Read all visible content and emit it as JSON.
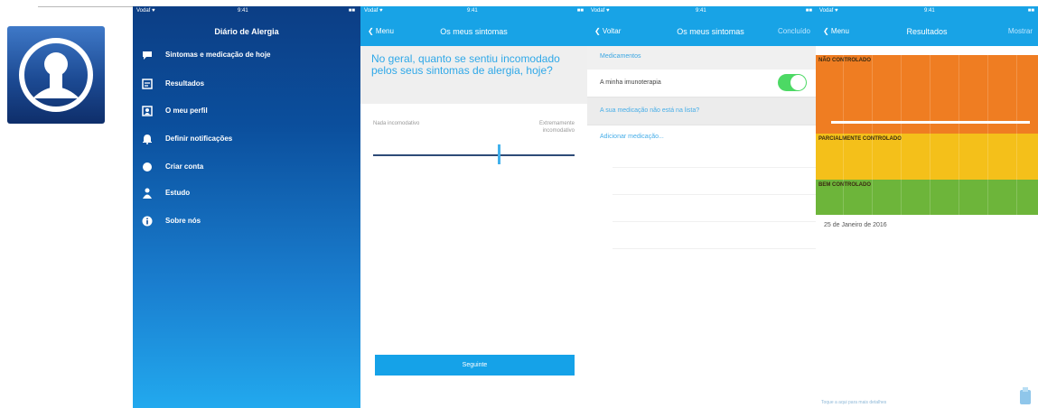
{
  "screens": {
    "menu": {
      "status": {
        "carrier": "Vodaf ♥",
        "time": "9:41",
        "battery": "■■"
      },
      "title": "Diário de Alergia",
      "items": [
        {
          "label": "Sintomas e medicação de hoje",
          "icon": "speech-bubble-icon"
        },
        {
          "label": "Resultados",
          "icon": "results-icon"
        },
        {
          "label": "O meu perfil",
          "icon": "profile-card-icon"
        },
        {
          "label": "Definir notificações",
          "icon": "bell-icon"
        },
        {
          "label": "Criar conta",
          "icon": "account-icon"
        },
        {
          "label": "Estudo",
          "icon": "person-icon"
        },
        {
          "label": "Sobre nós",
          "icon": "info-icon"
        }
      ]
    },
    "symptoms": {
      "status": {
        "carrier": "Vodaf ♥",
        "time": "9:41",
        "battery": "■■"
      },
      "back": "❮ Menu",
      "title": "Os meus sintomas",
      "question": "No geral, quanto se sentiu incomodado pelos seus sintomas de alergia, hoje?",
      "scale_left": "Nada incomodativo",
      "scale_right": "Extremamente incomodativo",
      "slider_value": 0.62,
      "next_label": "Seguinte"
    },
    "medication": {
      "status": {
        "carrier": "Vodaf ♥",
        "time": "9:41",
        "battery": "■■"
      },
      "back": "❮ Voltar",
      "title": "Os meus sintomas",
      "done": "Concluído",
      "section": "Medicamentos",
      "immunotherapy_label": "A minha imunoterapia",
      "immunotherapy_on": true,
      "not_in_list": "A sua medicação não está na lista?",
      "add_medication": "Adicionar medicação..."
    },
    "results": {
      "status": {
        "carrier": "Vodaf ♥",
        "time": "9:41",
        "battery": "■■"
      },
      "back": "❮ Menu",
      "title": "Resultados",
      "right": "Mostrar",
      "bands": [
        {
          "label": "NÃO CONTROLADO",
          "color": "#ef7d22"
        },
        {
          "label": "PARCIALMENTE CONTROLADO",
          "color": "#f4c01a"
        },
        {
          "label": "BEM CONTROLADO",
          "color": "#6db53a"
        }
      ],
      "date": "25 de Janeiro de 2016",
      "footer": "Toque a aqui para mais detalhes"
    }
  },
  "colors": {
    "accent": "#18a3e6",
    "menu_top": "#0c3e85",
    "toggle_on": "#4cd964"
  }
}
